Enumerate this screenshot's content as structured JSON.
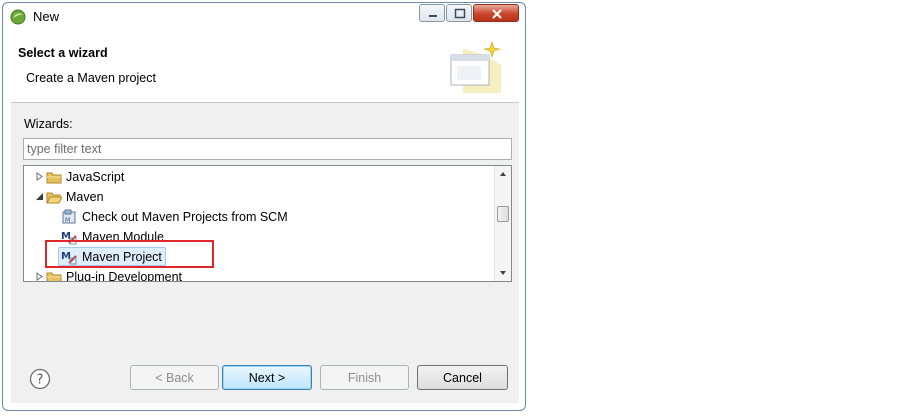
{
  "window": {
    "title": "New"
  },
  "header": {
    "title": "Select a wizard",
    "description": "Create a Maven project"
  },
  "wizards": {
    "label": "Wizards:",
    "filter_placeholder": "type filter text",
    "tree": [
      {
        "label": "JavaScript",
        "expanded": false,
        "type": "folder"
      },
      {
        "label": "Maven",
        "expanded": true,
        "type": "folder"
      },
      {
        "label": "Check out Maven Projects from SCM",
        "type": "item"
      },
      {
        "label": "Maven Module",
        "type": "item"
      },
      {
        "label": "Maven Project",
        "type": "item",
        "selected": true
      },
      {
        "label": "Plug-in Development",
        "expanded": false,
        "type": "folder"
      }
    ]
  },
  "buttons": {
    "back": "< Back",
    "next": "Next >",
    "finish": "Finish",
    "cancel": "Cancel"
  },
  "colors": {
    "highlight": "#e0262c",
    "selection": "#dfeefc",
    "folder": "#e8c15a"
  },
  "icons": [
    "app-icon",
    "wizard-banner-icon",
    "folder-icon",
    "maven-icon",
    "help-icon",
    "expand-arrow-icon",
    "collapse-arrow-icon"
  ]
}
